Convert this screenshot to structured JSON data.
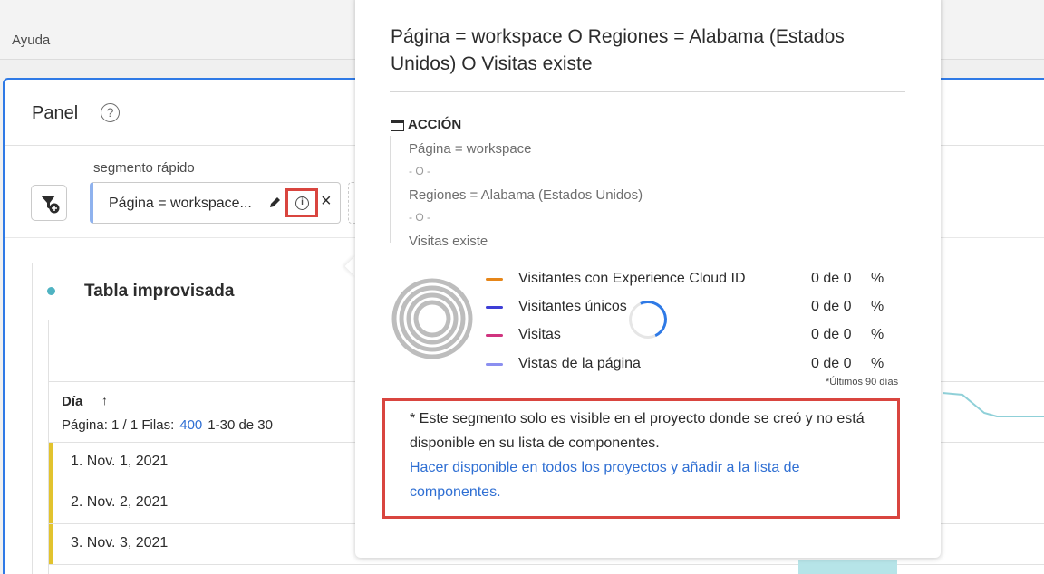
{
  "menubar": {
    "help": "Ayuda"
  },
  "panel": {
    "title": "Panel",
    "help_glyph": "?"
  },
  "segment": {
    "label": "segmento rápido",
    "chip_text": "Página = workspace...",
    "close_glyph": "×"
  },
  "table": {
    "title": "Tabla improvisada",
    "dimension": "Día",
    "sort_glyph": "↑",
    "pager_prefix": "Página: 1 / 1 Filas:",
    "rows_value": "400",
    "range": "1-30 de 30",
    "rows": [
      "1. Nov. 1, 2021",
      "2. Nov. 2, 2021",
      "3. Nov. 3, 2021"
    ]
  },
  "popover": {
    "title": "Página = workspace O Regiones = Alabama (Estados Unidos) O Visitas existe",
    "context": "ACCIÓN",
    "rules": [
      "Página = workspace",
      "Regiones = Alabama (Estados Unidos)",
      "Visitas existe"
    ],
    "operator": "- O -",
    "metrics": [
      {
        "name": "Visitantes con Experience Cloud ID",
        "value": "0 de 0",
        "pct": "%",
        "color": "#e68619"
      },
      {
        "name": "Visitantes únicos",
        "value": "0 de 0",
        "pct": "%",
        "color": "#3e3ed6"
      },
      {
        "name": "Visitas",
        "value": "0 de 0",
        "pct": "%",
        "color": "#d0347f"
      },
      {
        "name": "Vistas de la página",
        "value": "0 de 0",
        "pct": "%",
        "color": "#8b8ff0"
      }
    ],
    "days_note": "*Últimos 90 días",
    "notice_text": "* Este segmento solo es visible en el proyecto donde se creó y no está disponible en su lista de componentes.",
    "notice_link": "Hacer disponible en todos los proyectos y añadir a la lista de componentes."
  }
}
